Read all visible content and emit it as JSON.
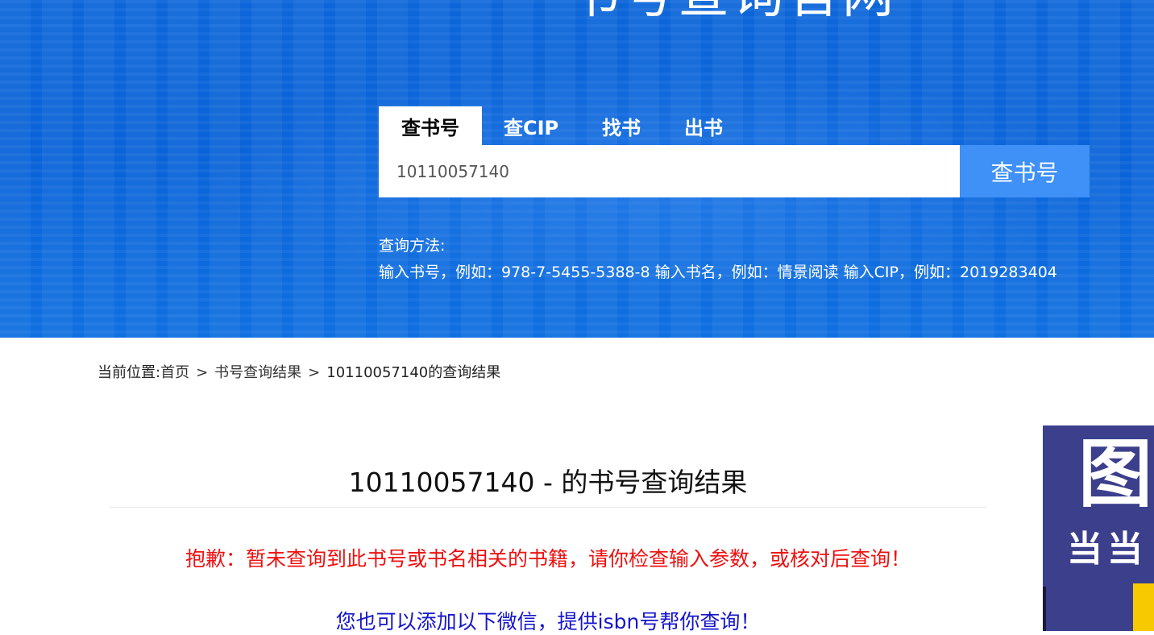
{
  "header": {
    "site_title": "书号查询官网"
  },
  "tabs": [
    {
      "label": "查书号",
      "active": true
    },
    {
      "label": "查CIP",
      "active": false
    },
    {
      "label": "找书",
      "active": false
    },
    {
      "label": "出书",
      "active": false
    }
  ],
  "search": {
    "value": "10110057140",
    "button_label": "查书号"
  },
  "help": {
    "title": "查询方法:",
    "text": "输入书号，例如：978-7-5455-5388-8 输入书名，例如：情景阅读 输入CIP，例如：2019283404"
  },
  "breadcrumb": {
    "prefix": "当前位置:",
    "home": "首页",
    "sep": ">",
    "level2": "书号查询结果",
    "current": "10110057140的查询结果"
  },
  "result": {
    "title": "10110057140 - 的书号查询结果",
    "sorry": "抱歉：暂未查询到此书号或书名相关的书籍，请你检查输入参数，或核对后查询！",
    "wechat": "您也可以添加以下微信，提供isbn号帮你查询！"
  },
  "ad": {
    "big_char": "图",
    "sub_text": "当当"
  },
  "colors": {
    "hero_blue": "#0a63d8",
    "button_blue": "#3f90f7",
    "error_red": "#ee1111",
    "link_blue": "#1515cc"
  }
}
